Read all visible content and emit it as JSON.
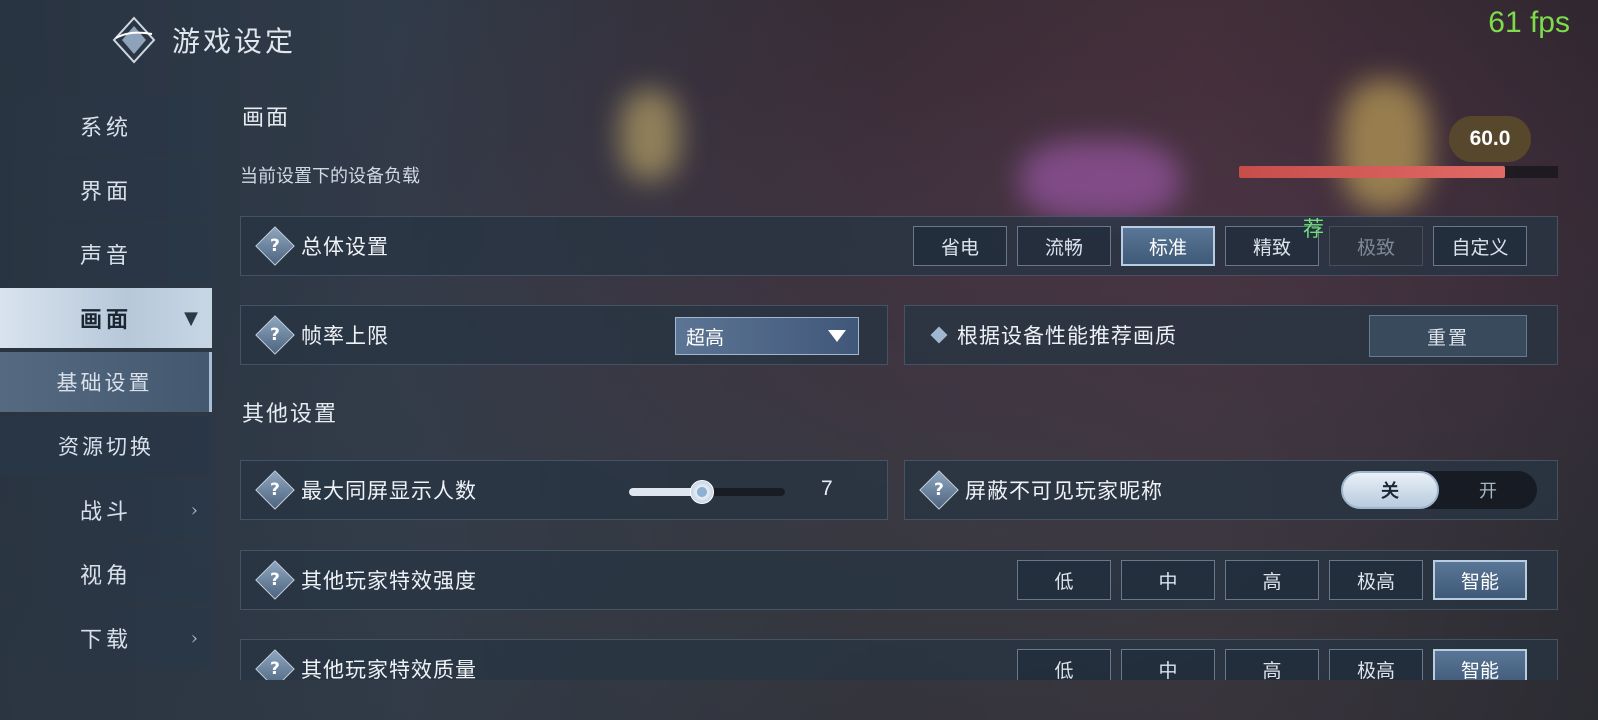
{
  "fps": "61 fps",
  "header": {
    "title": "游戏设定"
  },
  "sidebar": {
    "items": [
      {
        "label": "系统"
      },
      {
        "label": "界面"
      },
      {
        "label": "声音"
      },
      {
        "label": "画面",
        "active": true
      },
      {
        "label": "基础设置",
        "sub": true,
        "active": true
      },
      {
        "label": "资源切换",
        "sub": true
      },
      {
        "label": "战斗"
      },
      {
        "label": "视角"
      },
      {
        "label": "下载"
      }
    ]
  },
  "section_picture": {
    "title": "画面",
    "load_label": "当前设置下的设备负载",
    "load_value": "60.0",
    "load_fraction": 0.83
  },
  "overall": {
    "label": "总体设置",
    "options": [
      "省电",
      "流畅",
      "标准",
      "精致",
      "极致",
      "自定义"
    ],
    "selected": "标准",
    "recommend_badge": "荐"
  },
  "framerate": {
    "label": "帧率上限",
    "value": "超高"
  },
  "recommend": {
    "label": "根据设备性能推荐画质",
    "button": "重置"
  },
  "section_other": {
    "title": "其他设置"
  },
  "max_players": {
    "label": "最大同屏显示人数",
    "value": "7",
    "fraction": 0.46
  },
  "hide_names": {
    "label": "屏蔽不可见玩家昵称",
    "off": "关",
    "on": "开"
  },
  "effect_strength": {
    "label": "其他玩家特效强度",
    "options": [
      "低",
      "中",
      "高",
      "极高",
      "智能"
    ],
    "selected": "智能"
  },
  "effect_quality": {
    "label": "其他玩家特效质量",
    "options": [
      "低",
      "中",
      "高",
      "极高",
      "智能"
    ],
    "selected": "智能"
  },
  "colors": {
    "fps": "#7cdc4a",
    "load_bar": "#c74d4a",
    "recommend": "#6fe07a"
  }
}
